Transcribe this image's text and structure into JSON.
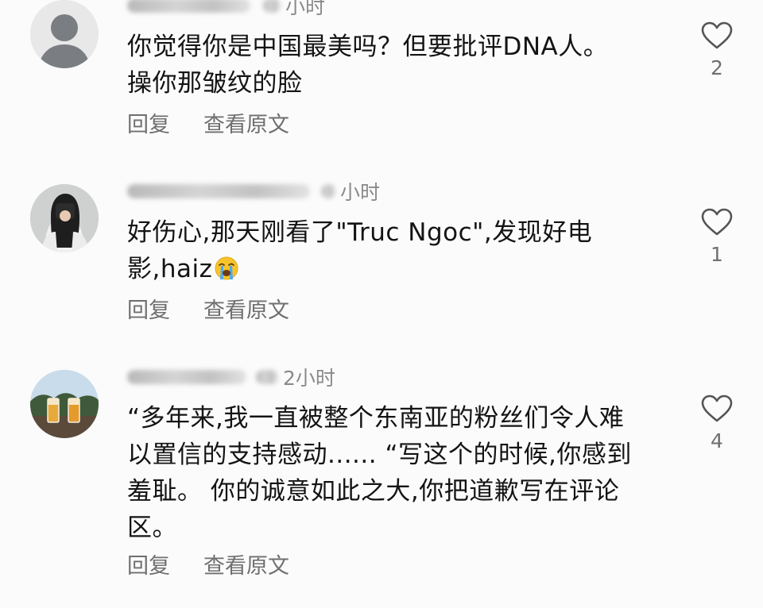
{
  "comments": [
    {
      "time": "小时",
      "line1": "你觉得你是中国最美吗？但要批评DNA人。",
      "line2": "操你那皱纹的脸",
      "reply_label": "回复",
      "translate_label": "查看原文",
      "likes": "2",
      "avatar_icon": "default-user-avatar"
    },
    {
      "time": "小时",
      "line1": "好伤心,那天刚看了\"Truc Ngoc\",发现好电",
      "line2": "影,haiz",
      "emoji": "loudly-crying-face",
      "reply_label": "回复",
      "translate_label": "查看原文",
      "likes": "1",
      "avatar_icon": "photo-avatar-person"
    },
    {
      "time": "2小时",
      "line1": "“多年来,我一直被整个东南亚的粉丝们令人难",
      "line2": "以置信的支持感动...... “写这个的时候,你感到",
      "line3": "羞耻。 你的诚意如此之大,你把道歉写在评论",
      "line4": "区。",
      "reply_label": "回复",
      "translate_label": "查看原文",
      "likes": "4",
      "avatar_icon": "photo-avatar-drinks"
    }
  ],
  "colors": {
    "text": "#141414",
    "secondary": "#6f6f6f",
    "meta": "#8a8a8a",
    "heart_stroke": "#555555"
  }
}
